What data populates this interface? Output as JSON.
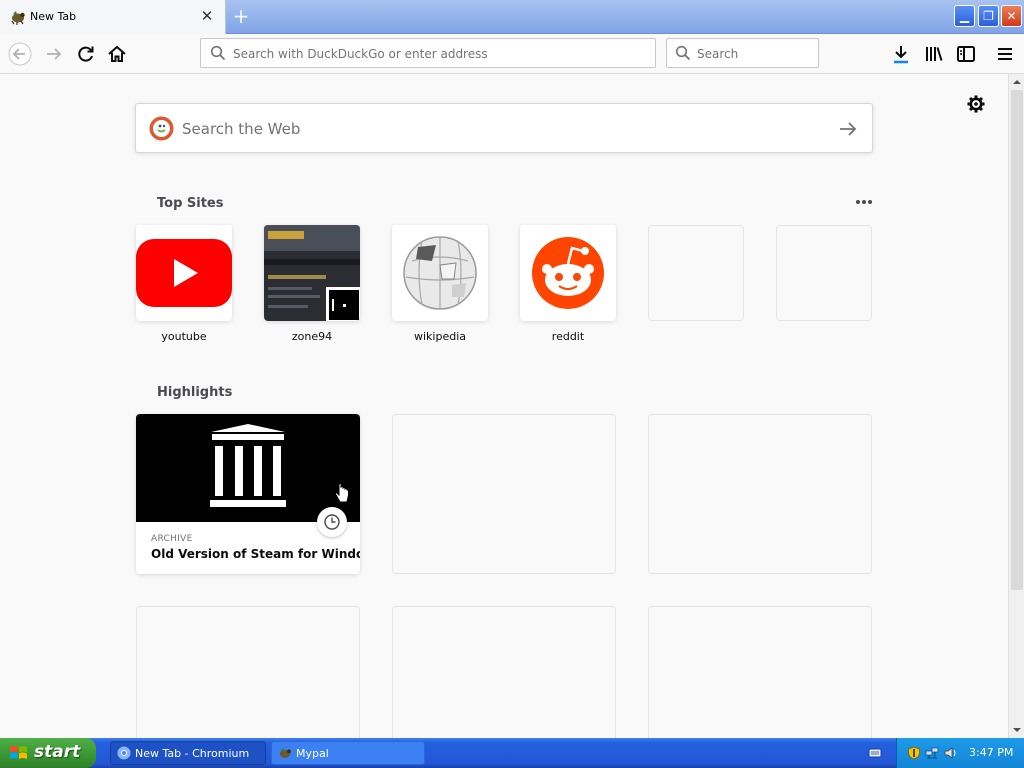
{
  "browser": {
    "tab": {
      "title": "New Tab",
      "close_glyph": "✕",
      "favicon": "mypal-icon"
    },
    "new_tab_glyph": "+",
    "window_buttons": {
      "minimize": "▁",
      "maximize": "❐",
      "close": "✕"
    },
    "toolbar": {
      "back_icon": "back-arrow-icon",
      "forward_icon": "forward-arrow-icon",
      "reload_icon": "reload-icon",
      "home_icon": "home-icon",
      "urlbar_placeholder": "Search with DuckDuckGo or enter address",
      "searchbar_placeholder": "Search",
      "download_icon": "download-icon",
      "library_icon": "library-icon",
      "sidebar_icon": "sidebar-icon",
      "menu_icon": "hamburger-menu-icon"
    }
  },
  "newtab": {
    "settings_icon": "gear-icon",
    "search": {
      "placeholder": "Search the Web",
      "engine_icon": "duckduckgo-icon",
      "go_icon": "arrow-right-icon"
    },
    "top_sites": {
      "title": "Top Sites",
      "menu_glyph": "•••",
      "sites": [
        {
          "label": "youtube",
          "icon": "youtube-logo"
        },
        {
          "label": "zone94",
          "icon": "zone94-thumbnail"
        },
        {
          "label": "wikipedia",
          "icon": "wikipedia-globe"
        },
        {
          "label": "reddit",
          "icon": "reddit-logo"
        },
        {
          "label": "",
          "icon": ""
        },
        {
          "label": "",
          "icon": ""
        }
      ]
    },
    "highlights": {
      "title": "Highlights",
      "cards": [
        {
          "source": "ARCHIVE",
          "title": "Old Version of Steam for Windo...",
          "icon": "archive-building-icon",
          "badge": "clock-icon"
        }
      ]
    }
  },
  "taskbar": {
    "start_label": "start",
    "tasks": [
      {
        "label": "New Tab - Chromium",
        "icon": "chromium-icon"
      },
      {
        "label": "Mypal",
        "icon": "mypal-icon"
      }
    ],
    "clock": "3:47 PM"
  },
  "colors": {
    "youtube_red": "#ff0000",
    "reddit_orange": "#ff4500",
    "ddg_orange": "#de5833",
    "download_blue": "#0a84ff",
    "taskbar_blue": "#2357d8",
    "start_green": "#3c9b35"
  }
}
